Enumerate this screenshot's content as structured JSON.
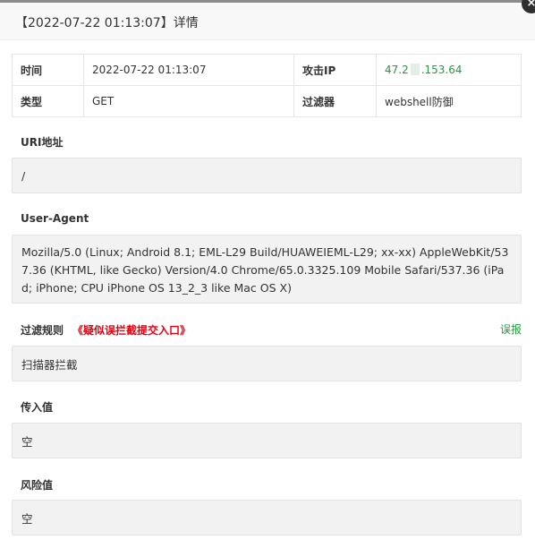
{
  "dialog": {
    "title": "【2022-07-22 01:13:07】详情",
    "close_glyph": "×"
  },
  "info": {
    "time_label": "时间",
    "time_value": "2022-07-22 01:13:07",
    "attack_ip_label": "攻击IP",
    "attack_ip_prefix": "47.2",
    "attack_ip_suffix": ".153.64",
    "type_label": "类型",
    "type_value": "GET",
    "filter_label": "过滤器",
    "filter_value": "webshell防御"
  },
  "uri": {
    "label": "URI地址",
    "value": "/"
  },
  "user_agent": {
    "label": "User-Agent",
    "value": "Mozilla/5.0 (Linux; Android 8.1; EML-L29 Build/HUAWEIEML-L29; xx-xx) AppleWebKit/537.36 (KHTML, like Gecko) Version/4.0 Chrome/65.0.3325.109 Mobile Safari/537.36 (iPad; iPhone; CPU iPhone OS 13_2_3 like Mac OS X)"
  },
  "filter_rule": {
    "label": "过滤规则",
    "link": "《疑似误拦截提交入口》",
    "report": "误报",
    "value": "扫描器拦截"
  },
  "input_value": {
    "label": "传入值",
    "value": "空"
  },
  "risk_value": {
    "label": "风险值",
    "value": "空"
  },
  "colors": {
    "accent_green": "#1e9d3c",
    "link_red": "#e60012"
  }
}
